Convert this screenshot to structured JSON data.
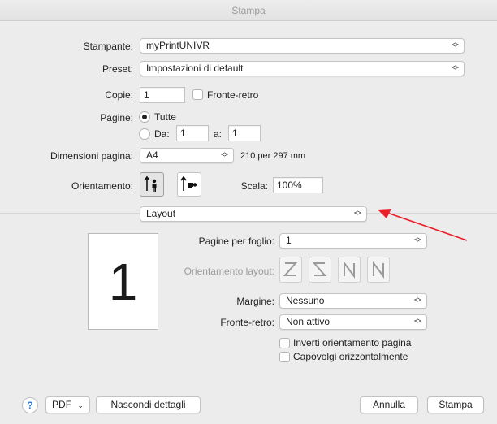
{
  "window": {
    "title": "Stampa"
  },
  "printer": {
    "label": "Stampante:",
    "value": "myPrintUNIVR"
  },
  "preset": {
    "label": "Preset:",
    "value": "Impostazioni di default"
  },
  "copies": {
    "label": "Copie:",
    "value": "1",
    "duplex_label": "Fronte-retro"
  },
  "pages": {
    "label": "Pagine:",
    "all_label": "Tutte",
    "from_label": "Da:",
    "from_value": "1",
    "to_label": "a:",
    "to_value": "1"
  },
  "paper_size": {
    "label": "Dimensioni pagina:",
    "value": "A4",
    "dims": "210 per 297 mm"
  },
  "orientation": {
    "label": "Orientamento:"
  },
  "scale": {
    "label": "Scala:",
    "value": "100%"
  },
  "section": {
    "value": "Layout"
  },
  "preview": {
    "page_number": "1"
  },
  "layout": {
    "pages_per_sheet_label": "Pagine per foglio:",
    "pages_per_sheet_value": "1",
    "layout_direction_label": "Orientamento layout:",
    "border_label": "Margine:",
    "border_value": "Nessuno",
    "two_sided_label": "Fronte-retro:",
    "two_sided_value": "Non attivo",
    "reverse_orientation_label": "Inverti orientamento pagina",
    "flip_horizontal_label": "Capovolgi orizzontalmente"
  },
  "footer": {
    "help_label": "?",
    "pdf_label": "PDF",
    "hide_details_label": "Nascondi dettagli",
    "cancel_label": "Annulla",
    "print_label": "Stampa"
  },
  "colors": {
    "annotation_arrow": "#e8202a",
    "help_icon": "#2a7ad7"
  }
}
